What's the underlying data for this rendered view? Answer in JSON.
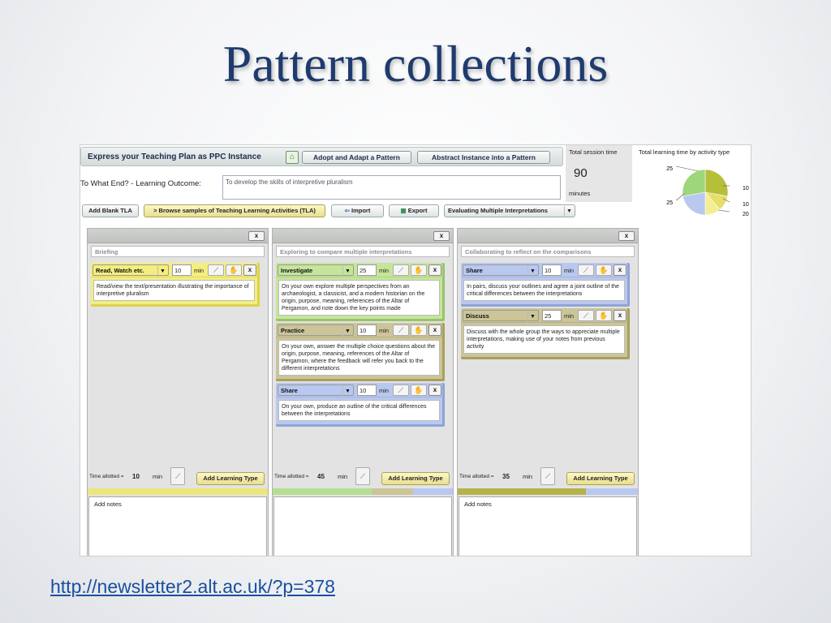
{
  "slide": {
    "title": "Pattern collections",
    "link": "http://newsletter2.alt.ac.uk/?p=378"
  },
  "app": {
    "header": {
      "title": "Express your Teaching Plan as PPC Instance",
      "adopt_label": "Adopt and Adapt a Pattern",
      "abstract_label": "Abstract Instance into a Pattern",
      "home_icon": "home-icon"
    },
    "session": {
      "label": "Total session time",
      "value": "90",
      "unit": "minutes"
    },
    "pie": {
      "title": "Total learning time by activity type",
      "labels": [
        "25",
        "25",
        "10",
        "10",
        "20"
      ],
      "slices": [
        {
          "value": 25,
          "color": "#b6bf3a"
        },
        {
          "value": 10,
          "color": "#e7df6a"
        },
        {
          "value": 10,
          "color": "#f3ee92"
        },
        {
          "value": 20,
          "color": "#b9c8ef"
        },
        {
          "value": 25,
          "color": "#9ed67c"
        }
      ]
    },
    "outcome": {
      "label": "To What End? - Learning Outcome:",
      "value": "To develop the skills of interpretive pluralism"
    },
    "toolbar": {
      "add_blank": "Add Blank TLA",
      "browse": "> Browse samples of Teaching Learning Activities (TLA)",
      "import": "Import",
      "export": "Export",
      "evaluating": "Evaluating Multiple Interpretations"
    },
    "columns": [
      {
        "title": "Briefing",
        "close": "x",
        "activities": [
          {
            "type": "Read, Watch etc.",
            "minutes": "10",
            "unit": "min",
            "desc": "Read/view the text/presentation illustrating the importance of interpretive pluralism",
            "style": "yellowA"
          }
        ],
        "time_label": "Time allotted =",
        "time_value": "10",
        "time_unit": "min",
        "add_label": "Add Learning Type",
        "notes": "Add notes",
        "strip": [
          {
            "color": "#ece77a",
            "w": 100
          }
        ]
      },
      {
        "title": "Exploring to compare multiple interpretations",
        "close": "x",
        "activities": [
          {
            "type": "Investigate",
            "minutes": "25",
            "unit": "min",
            "desc": "On your own explore multiple perspectives from an archaeologist, a classicist, and a modern historian on the origin, purpose, meaning, references of the Altar of Pergamon, and note down the key points made",
            "style": "greenA"
          },
          {
            "type": "Practice",
            "minutes": "10",
            "unit": "min",
            "desc": "On your own, answer the multiple choice questions about the origin, purpose, meaning, references of the Altar of Pergamon, where the feedback will refer you back to the different interpretations",
            "style": "oliveA"
          },
          {
            "type": "Share",
            "minutes": "10",
            "unit": "min",
            "desc": "On your own, produce an outline of the critical differences between the interpretations",
            "style": "blueA"
          }
        ],
        "time_label": "Time allotted =",
        "time_value": "45",
        "time_unit": "min",
        "add_label": "Add Learning Type",
        "notes": "",
        "strip": [
          {
            "color": "#b5de91",
            "w": 55
          },
          {
            "color": "#cbc598",
            "w": 23
          },
          {
            "color": "#b9c8ef",
            "w": 22
          }
        ]
      },
      {
        "title": "Collaborating to reflect on the comparisons",
        "close": "x",
        "activities": [
          {
            "type": "Share",
            "minutes": "10",
            "unit": "min",
            "desc": "In pairs, discuss your outlines and agree a joint outline of the critical differences between the interpretations",
            "style": "blueA"
          },
          {
            "type": "Discuss",
            "minutes": "25",
            "unit": "min",
            "desc": "Discuss with the whole group the ways to appreciate multiple interpretations, making use of your notes from previous activity",
            "style": "oliveA"
          }
        ],
        "time_label": "Time allotted =",
        "time_value": "35",
        "time_unit": "min",
        "add_label": "Add Learning Type",
        "notes": "Add notes",
        "strip": [
          {
            "color": "#b6b24a",
            "w": 71
          },
          {
            "color": "#b9c8ef",
            "w": 29
          }
        ]
      }
    ]
  }
}
